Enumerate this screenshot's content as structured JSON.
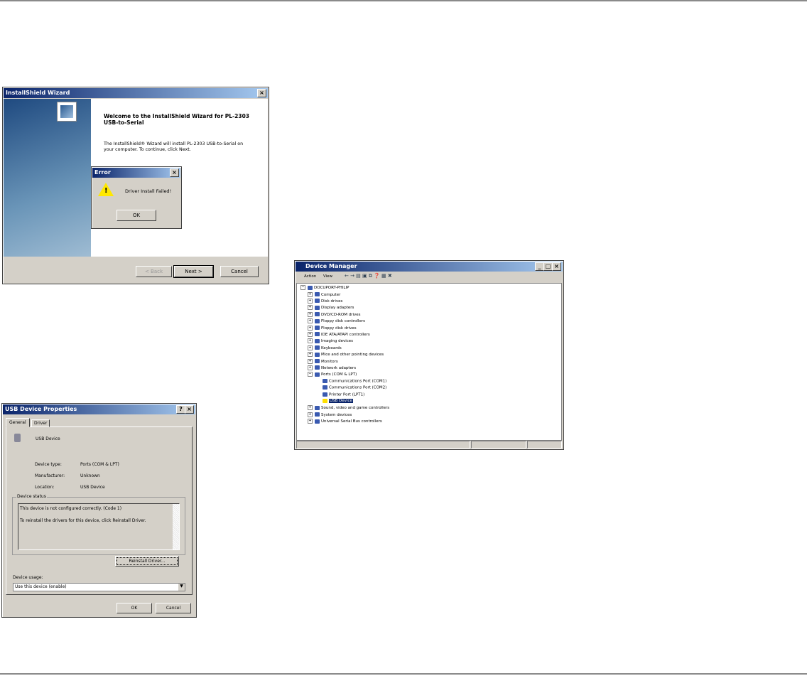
{
  "installshield": {
    "title": "InstallShield Wizard",
    "heading": "Welcome to the InstallShield Wizard for PL-2303 USB-to-Serial",
    "body": "The InstallShield® Wizard will install PL-2303 USB-to-Serial on your computer.  To continue, click Next.",
    "back": "< Back",
    "next": "Next >",
    "cancel": "Cancel"
  },
  "error": {
    "title": "Error",
    "message": "Driver Install Failed!",
    "ok": "OK"
  },
  "device_manager": {
    "title": "Device Manager",
    "menu": [
      "Action",
      "View"
    ],
    "root": "DOCUPORT-PHILIP",
    "items": [
      "Computer",
      "Disk drives",
      "Display adapters",
      "DVD/CD-ROM drives",
      "Floppy disk controllers",
      "Floppy disk drives",
      "IDE ATA/ATAPI controllers",
      "Imaging devices",
      "Keyboards",
      "Mice and other pointing devices",
      "Monitors",
      "Network adapters",
      "Ports (COM & LPT)"
    ],
    "ports": [
      "Communications Port (COM1)",
      "Communications Port (COM2)",
      "Printer Port (LPT1)",
      "USB Device"
    ],
    "after": [
      "Sound, video and game controllers",
      "System devices",
      "Universal Serial Bus controllers"
    ]
  },
  "props": {
    "title": "USB Device Properties",
    "tabs": [
      "General",
      "Driver"
    ],
    "device_name": "USB Device",
    "fields": [
      {
        "label": "Device type:",
        "value": "Ports (COM & LPT)"
      },
      {
        "label": "Manufacturer:",
        "value": "Unknown"
      },
      {
        "label": "Location:",
        "value": "USB Device"
      }
    ],
    "status_label": "Device status",
    "status_line1": "This device is not configured correctly. (Code 1)",
    "status_line2": "To reinstall the drivers for this device, click Reinstall Driver.",
    "reinstall": "Reinstall Driver...",
    "usage_label": "Device usage:",
    "usage_value": "Use this device (enable)",
    "ok": "OK",
    "cancel": "Cancel"
  }
}
